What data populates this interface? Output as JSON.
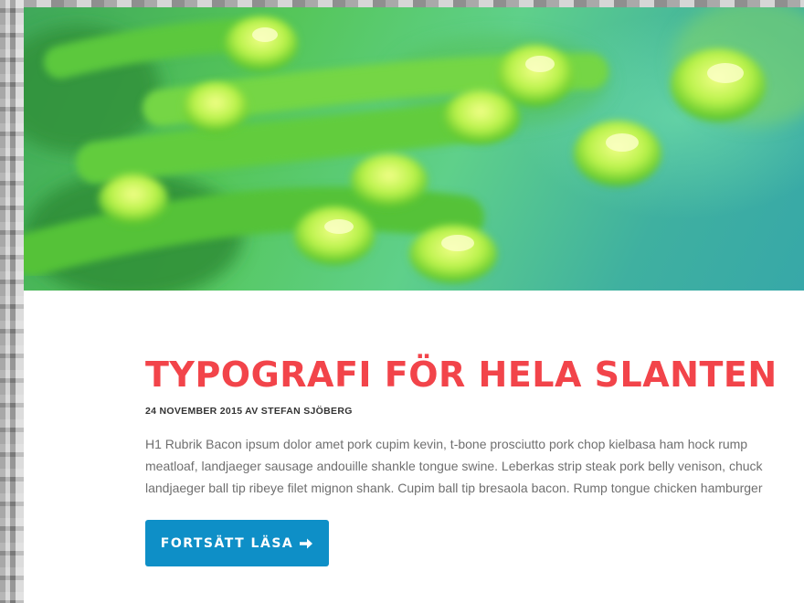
{
  "hero": {
    "image": "green-succulent-closeup-photo"
  },
  "post": {
    "title": "TYPOGRAFI FÖR HELA SLANTEN",
    "meta": "24 NOVEMBER 2015 AV STEFAN SJÖBERG",
    "excerpt_lines": [
      "H1 Rubrik Bacon ipsum dolor amet pork cupim kevin, t-bone prosciutto pork chop kielbasa ham hock rump",
      "meatloaf, landjaeger sausage andouille shankle tongue swine. Leberkas strip steak pork belly venison, chuck",
      "landjaeger ball tip ribeye filet mignon shank. Cupim ball tip bresaola bacon. Rump tongue chicken hamburger"
    ],
    "read_more_label": "FORTSÄTT LÄSA",
    "read_more_icon": "arrow-right-icon"
  },
  "colors": {
    "title": "#f2444a",
    "button": "#0e8fc7",
    "text": "#6f6f6f"
  }
}
